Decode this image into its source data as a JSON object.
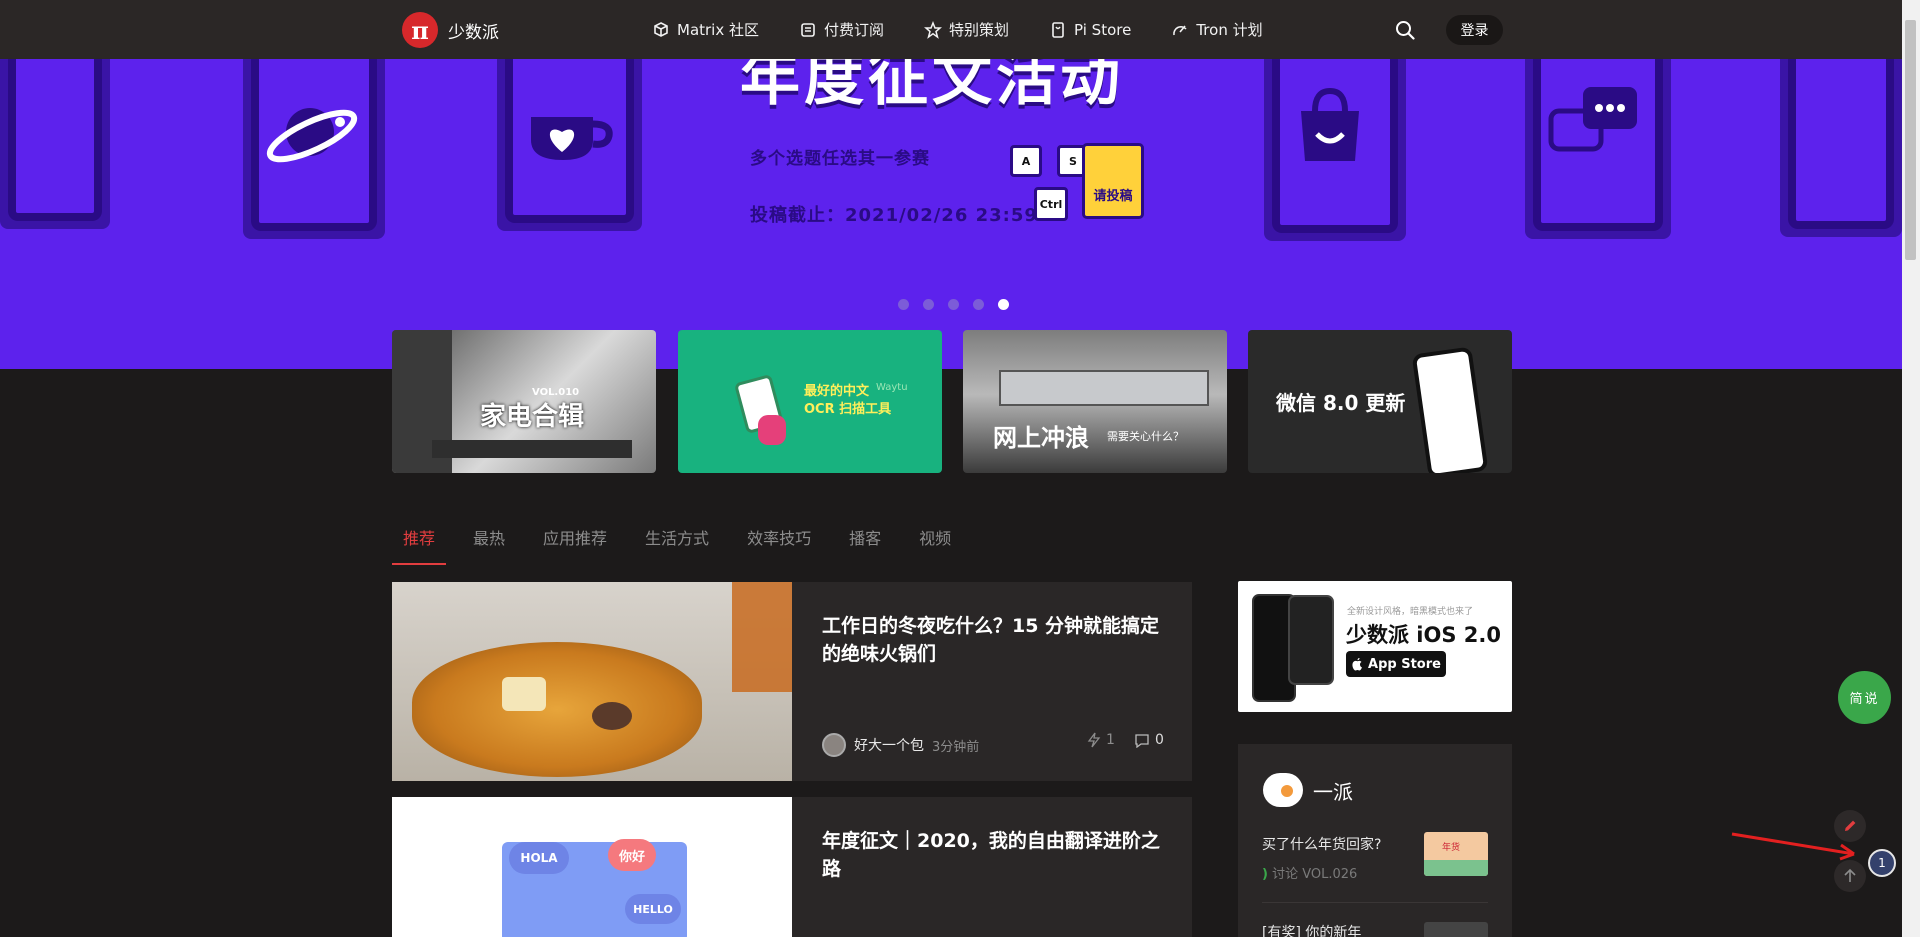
{
  "header": {
    "brand": "少数派",
    "logo_glyph": "π",
    "nav": [
      {
        "label": "Matrix 社区",
        "icon": "cube-icon"
      },
      {
        "label": "付费订阅",
        "icon": "subscription-icon"
      },
      {
        "label": "特别策划",
        "icon": "star-icon"
      },
      {
        "label": "Pi Store",
        "icon": "store-icon"
      },
      {
        "label": "Tron 计划",
        "icon": "tron-icon"
      }
    ],
    "login": "登录"
  },
  "banner": {
    "title": "年度征文活动",
    "subtitle": "多个选题任选其一参赛",
    "deadline": "投稿截止：2021/02/26  23:59",
    "keys": [
      "A",
      "S",
      "Ctrl"
    ],
    "submit": "请投稿",
    "slides": 5,
    "active_slide": 5
  },
  "tiles": [
    {
      "text": "家电合辑",
      "badge": "VOL.010"
    },
    {
      "text": "最好的中文",
      "text2": "OCR 扫描工具",
      "badge": "Waytu"
    },
    {
      "text": "网上冲浪",
      "text2": "需要关心什么？"
    },
    {
      "text": "微信 8.0 更新"
    }
  ],
  "tabs": [
    "推荐",
    "最热",
    "应用推荐",
    "生活方式",
    "效率技巧",
    "播客",
    "视频"
  ],
  "articles": [
    {
      "title": "工作日的冬夜吃什么？15 分钟就能搞定的绝味火锅们",
      "author": "好大一个包",
      "time": "3分钟前",
      "likes": "1",
      "comments": "0"
    },
    {
      "title": "年度征文｜2020，我的自由翻译进阶之路",
      "bubbles": [
        "HOLA",
        "你好",
        "HELLO"
      ]
    }
  ],
  "sidebar": {
    "ad": {
      "tagline": "全新设计风格，暗黑模式也来了",
      "title": "少数派 iOS 2.0",
      "store": "App Store"
    },
    "yipai": {
      "title": "一派",
      "question": "买了什么年货回家?",
      "tag": "讨论 VOL.026",
      "thumb_text": "年货",
      "next": "[有奖] 你的新年"
    }
  },
  "floating": {
    "quick": "简说",
    "badge_count": "1"
  },
  "colors": {
    "nav_bg": "#2b2726",
    "banner_purple": "#5d22ed",
    "accent_red": "#e23d3f",
    "green": "#3aa74a"
  }
}
